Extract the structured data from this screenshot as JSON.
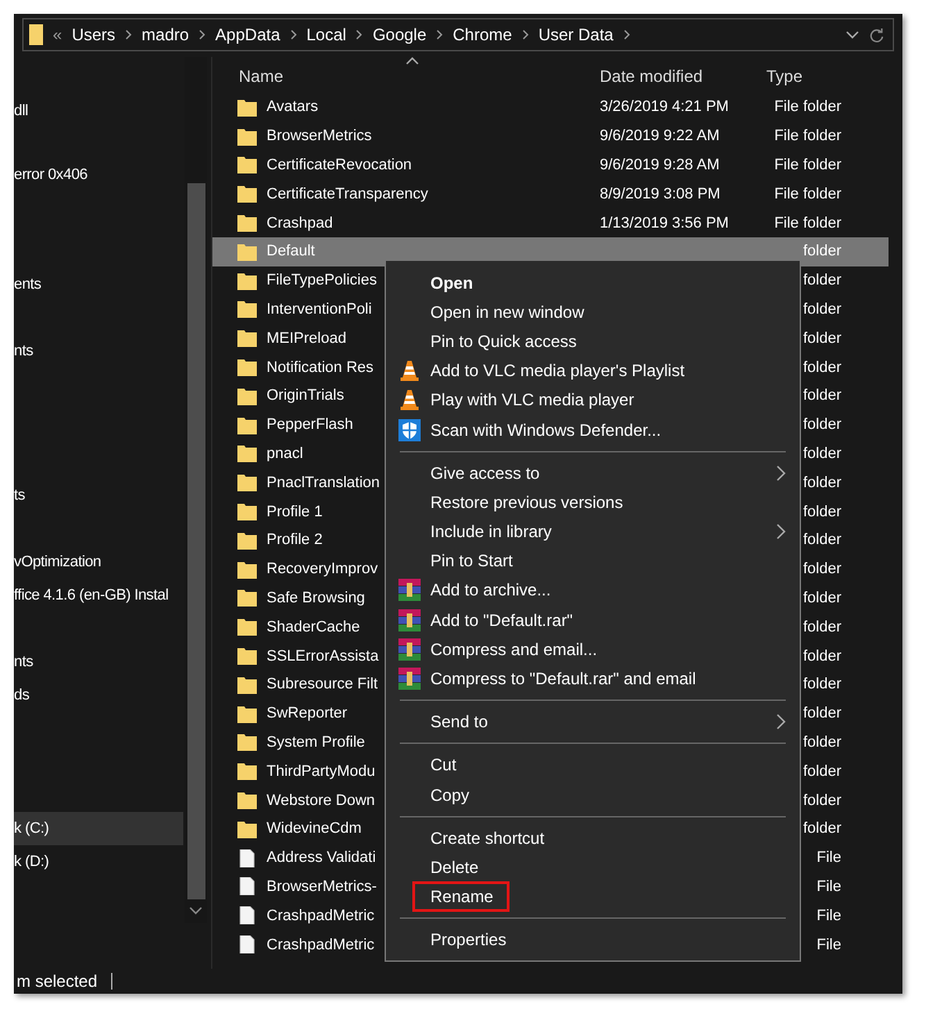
{
  "address_bar": {
    "overflow": "«",
    "crumbs": [
      "Users",
      "madro",
      "AppData",
      "Local",
      "Google",
      "Chrome",
      "User Data"
    ]
  },
  "columns": [
    "Name",
    "Date modified",
    "Type"
  ],
  "sidebar": {
    "items": [
      {
        "label": "dll",
        "selected": false
      },
      {
        "label": "error 0x406",
        "selected": false
      },
      {
        "label": "ents",
        "selected": false
      },
      {
        "label": "nts",
        "selected": false
      },
      {
        "label": "ts",
        "selected": false
      },
      {
        "label": "vOptimization",
        "selected": false
      },
      {
        "label": "ffice 4.1.6 (en-GB) Instal",
        "selected": false
      },
      {
        "label": "nts",
        "selected": false
      },
      {
        "label": "ds",
        "selected": false
      },
      {
        "label": "k (C:)",
        "selected": true
      },
      {
        "label": "k (D:)",
        "selected": false
      }
    ]
  },
  "rows": [
    {
      "kind": "folder",
      "name": "Avatars",
      "date": "3/26/2019 4:21 PM",
      "type": "File folder",
      "selected": false
    },
    {
      "kind": "folder",
      "name": "BrowserMetrics",
      "date": "9/6/2019 9:22 AM",
      "type": "File folder",
      "selected": false
    },
    {
      "kind": "folder",
      "name": "CertificateRevocation",
      "date": "9/6/2019 9:28 AM",
      "type": "File folder",
      "selected": false
    },
    {
      "kind": "folder",
      "name": "CertificateTransparency",
      "date": "8/9/2019 3:08 PM",
      "type": "File folder",
      "selected": false
    },
    {
      "kind": "folder",
      "name": "Crashpad",
      "date": "1/13/2019 3:56 PM",
      "type": "File folder",
      "selected": false
    },
    {
      "kind": "folder",
      "name": "Default",
      "type": "folder",
      "selected": true
    },
    {
      "kind": "folder",
      "name": "FileTypePolicies",
      "type": "folder",
      "selected": false
    },
    {
      "kind": "folder",
      "name": "InterventionPoli",
      "type": "folder",
      "selected": false
    },
    {
      "kind": "folder",
      "name": "MEIPreload",
      "type": "folder",
      "selected": false
    },
    {
      "kind": "folder",
      "name": "Notification Res",
      "type": "folder",
      "selected": false
    },
    {
      "kind": "folder",
      "name": "OriginTrials",
      "type": "folder",
      "selected": false
    },
    {
      "kind": "folder",
      "name": "PepperFlash",
      "type": "folder",
      "selected": false
    },
    {
      "kind": "folder",
      "name": "pnacl",
      "type": "folder",
      "selected": false
    },
    {
      "kind": "folder",
      "name": "PnaclTranslation",
      "type": "folder",
      "selected": false
    },
    {
      "kind": "folder",
      "name": "Profile 1",
      "type": "folder",
      "selected": false
    },
    {
      "kind": "folder",
      "name": "Profile 2",
      "type": "folder",
      "selected": false
    },
    {
      "kind": "folder",
      "name": "RecoveryImprov",
      "type": "folder",
      "selected": false
    },
    {
      "kind": "folder",
      "name": "Safe Browsing",
      "type": "folder",
      "selected": false
    },
    {
      "kind": "folder",
      "name": "ShaderCache",
      "type": "folder",
      "selected": false
    },
    {
      "kind": "folder",
      "name": "SSLErrorAssista",
      "type": "folder",
      "selected": false
    },
    {
      "kind": "folder",
      "name": "Subresource Filt",
      "type": "folder",
      "selected": false
    },
    {
      "kind": "folder",
      "name": "SwReporter",
      "type": "folder",
      "selected": false
    },
    {
      "kind": "folder",
      "name": "System Profile",
      "type": "folder",
      "selected": false
    },
    {
      "kind": "folder",
      "name": "ThirdPartyModu",
      "type": "folder",
      "selected": false
    },
    {
      "kind": "folder",
      "name": "Webstore Down",
      "type": "folder",
      "selected": false
    },
    {
      "kind": "folder",
      "name": "WidevineCdm",
      "type": "folder",
      "selected": false
    },
    {
      "kind": "file",
      "name": "Address Validati",
      "type": "File",
      "selected": false
    },
    {
      "kind": "file",
      "name": "BrowserMetrics-",
      "type": "File",
      "selected": false
    },
    {
      "kind": "file",
      "name": "CrashpadMetric",
      "type": "File",
      "selected": false
    },
    {
      "kind": "file",
      "name": "CrashpadMetric",
      "type": "File",
      "selected": false
    }
  ],
  "context_menu": [
    {
      "kind": "item",
      "label": "Open",
      "bold": true
    },
    {
      "kind": "item",
      "label": "Open in new window"
    },
    {
      "kind": "item",
      "label": "Pin to Quick access"
    },
    {
      "kind": "vlc",
      "label": "Add to VLC media player's Playlist"
    },
    {
      "kind": "vlc",
      "label": "Play with VLC media player"
    },
    {
      "kind": "defender",
      "label": "Scan with Windows Defender..."
    },
    {
      "kind": "separator"
    },
    {
      "kind": "submenu",
      "label": "Give access to"
    },
    {
      "kind": "item",
      "label": "Restore previous versions"
    },
    {
      "kind": "submenu",
      "label": "Include in library"
    },
    {
      "kind": "item",
      "label": "Pin to Start"
    },
    {
      "kind": "rar",
      "label": "Add to archive..."
    },
    {
      "kind": "rar",
      "label": "Add to \"Default.rar\""
    },
    {
      "kind": "rar",
      "label": "Compress and email..."
    },
    {
      "kind": "rar",
      "label": "Compress to \"Default.rar\" and email"
    },
    {
      "kind": "separator"
    },
    {
      "kind": "submenu",
      "label": "Send to"
    },
    {
      "kind": "separator"
    },
    {
      "kind": "item",
      "label": "Cut"
    },
    {
      "kind": "item",
      "label": "Copy"
    },
    {
      "kind": "separator"
    },
    {
      "kind": "item",
      "label": "Create shortcut"
    },
    {
      "kind": "item",
      "label": "Delete"
    },
    {
      "kind": "item",
      "label": "Rename",
      "highlighted": true
    },
    {
      "kind": "separator"
    },
    {
      "kind": "item",
      "label": "Properties"
    }
  ],
  "status_bar": {
    "text": "m selected"
  }
}
